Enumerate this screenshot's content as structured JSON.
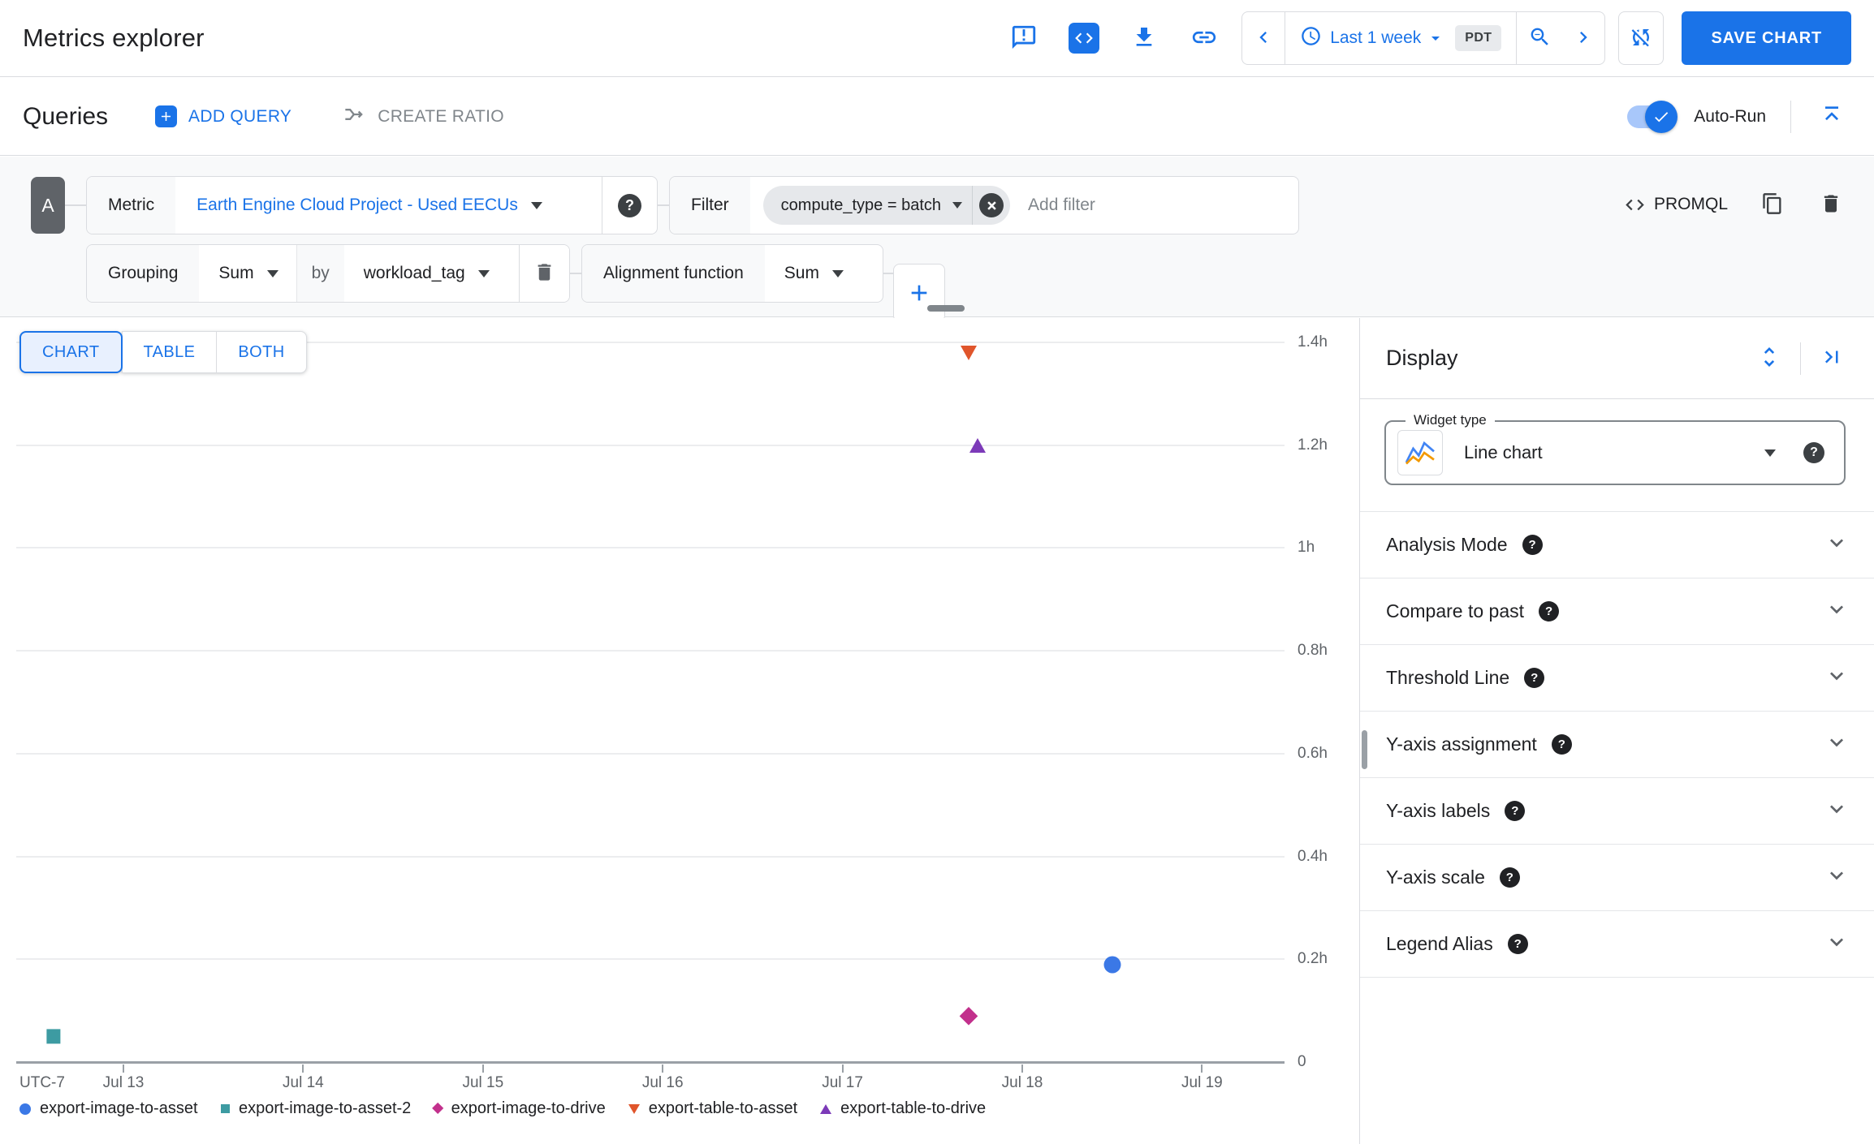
{
  "header": {
    "title": "Metrics explorer",
    "toolbar_icons": [
      "feedback-icon",
      "code-icon",
      "download-icon",
      "link-icon"
    ],
    "time_range": {
      "label": "Last 1 week",
      "timezone": "PDT"
    },
    "save_button": "SAVE CHART"
  },
  "queries_bar": {
    "heading": "Queries",
    "add_query_label": "ADD QUERY",
    "create_ratio_label": "CREATE RATIO",
    "auto_run_label": "Auto-Run",
    "auto_run_enabled": true
  },
  "query_builder": {
    "query_id": "A",
    "metric": {
      "label": "Metric",
      "value": "Earth Engine Cloud Project - Used EECUs"
    },
    "filter": {
      "label": "Filter",
      "chip": "compute_type = batch",
      "placeholder": "Add filter"
    },
    "promql_label": "PROMQL",
    "grouping": {
      "label": "Grouping",
      "value": "Sum",
      "by_label": "by",
      "by_value": "workload_tag"
    },
    "alignment": {
      "label": "Alignment function",
      "value": "Sum"
    }
  },
  "view_tabs": [
    {
      "label": "CHART",
      "active": true
    },
    {
      "label": "TABLE",
      "active": false
    },
    {
      "label": "BOTH",
      "active": false
    }
  ],
  "chart_data": {
    "type": "scatter",
    "title": "",
    "xlabel": "",
    "ylabel": "",
    "timezone_label": "UTC-7",
    "grid": true,
    "legend_position": "bottom",
    "y_unit": "hours",
    "ylim": [
      0,
      1.4
    ],
    "y_ticks": [
      {
        "label": "1.4h",
        "value": 1.4
      },
      {
        "label": "1.2h",
        "value": 1.2
      },
      {
        "label": "1h",
        "value": 1.0
      },
      {
        "label": "0.8h",
        "value": 0.8
      },
      {
        "label": "0.6h",
        "value": 0.6
      },
      {
        "label": "0.4h",
        "value": 0.4
      },
      {
        "label": "0.2h",
        "value": 0.2
      },
      {
        "label": "0",
        "value": 0
      }
    ],
    "x_ticks": [
      {
        "label": "Jul 13",
        "day": 13
      },
      {
        "label": "Jul 14",
        "day": 14
      },
      {
        "label": "Jul 15",
        "day": 15
      },
      {
        "label": "Jul 16",
        "day": 16
      },
      {
        "label": "Jul 17",
        "day": 17
      },
      {
        "label": "Jul 18",
        "day": 18
      },
      {
        "label": "Jul 19",
        "day": 19
      }
    ],
    "x_range_days": [
      12.4,
      19.46
    ],
    "series": [
      {
        "name": "export-image-to-asset",
        "marker": "circle",
        "color": "#3B78E6",
        "points": [
          {
            "time": "Jul 18 ~12:00",
            "day": 18.5,
            "value_hours": 0.19
          }
        ]
      },
      {
        "name": "export-image-to-asset-2",
        "marker": "square",
        "color": "#3D9BA2",
        "points": [
          {
            "time": "Jul 12 ~14:30",
            "day": 12.61,
            "value_hours": 0.05
          }
        ]
      },
      {
        "name": "export-image-to-drive",
        "marker": "diamond",
        "color": "#C2308C",
        "points": [
          {
            "time": "Jul 17 ~17:00",
            "day": 17.7,
            "value_hours": 0.09
          }
        ]
      },
      {
        "name": "export-table-to-asset",
        "marker": "triangle-down",
        "color": "#E0552B",
        "points": [
          {
            "time": "Jul 17 ~17:00",
            "day": 17.7,
            "value_hours": 1.38
          }
        ]
      },
      {
        "name": "export-table-to-drive",
        "marker": "triangle-up",
        "color": "#7C3AB8",
        "points": [
          {
            "time": "Jul 17 ~18:00",
            "day": 17.75,
            "value_hours": 1.2
          }
        ]
      }
    ]
  },
  "display_panel": {
    "title": "Display",
    "widget_type": {
      "label": "Widget type",
      "value": "Line chart"
    },
    "sections": [
      "Analysis Mode",
      "Compare to past",
      "Threshold Line",
      "Y-axis assignment",
      "Y-axis labels",
      "Y-axis scale",
      "Legend Alias"
    ]
  },
  "colors": {
    "accent": "#1A73E8",
    "text": "#202124",
    "muted": "#5F6368"
  }
}
